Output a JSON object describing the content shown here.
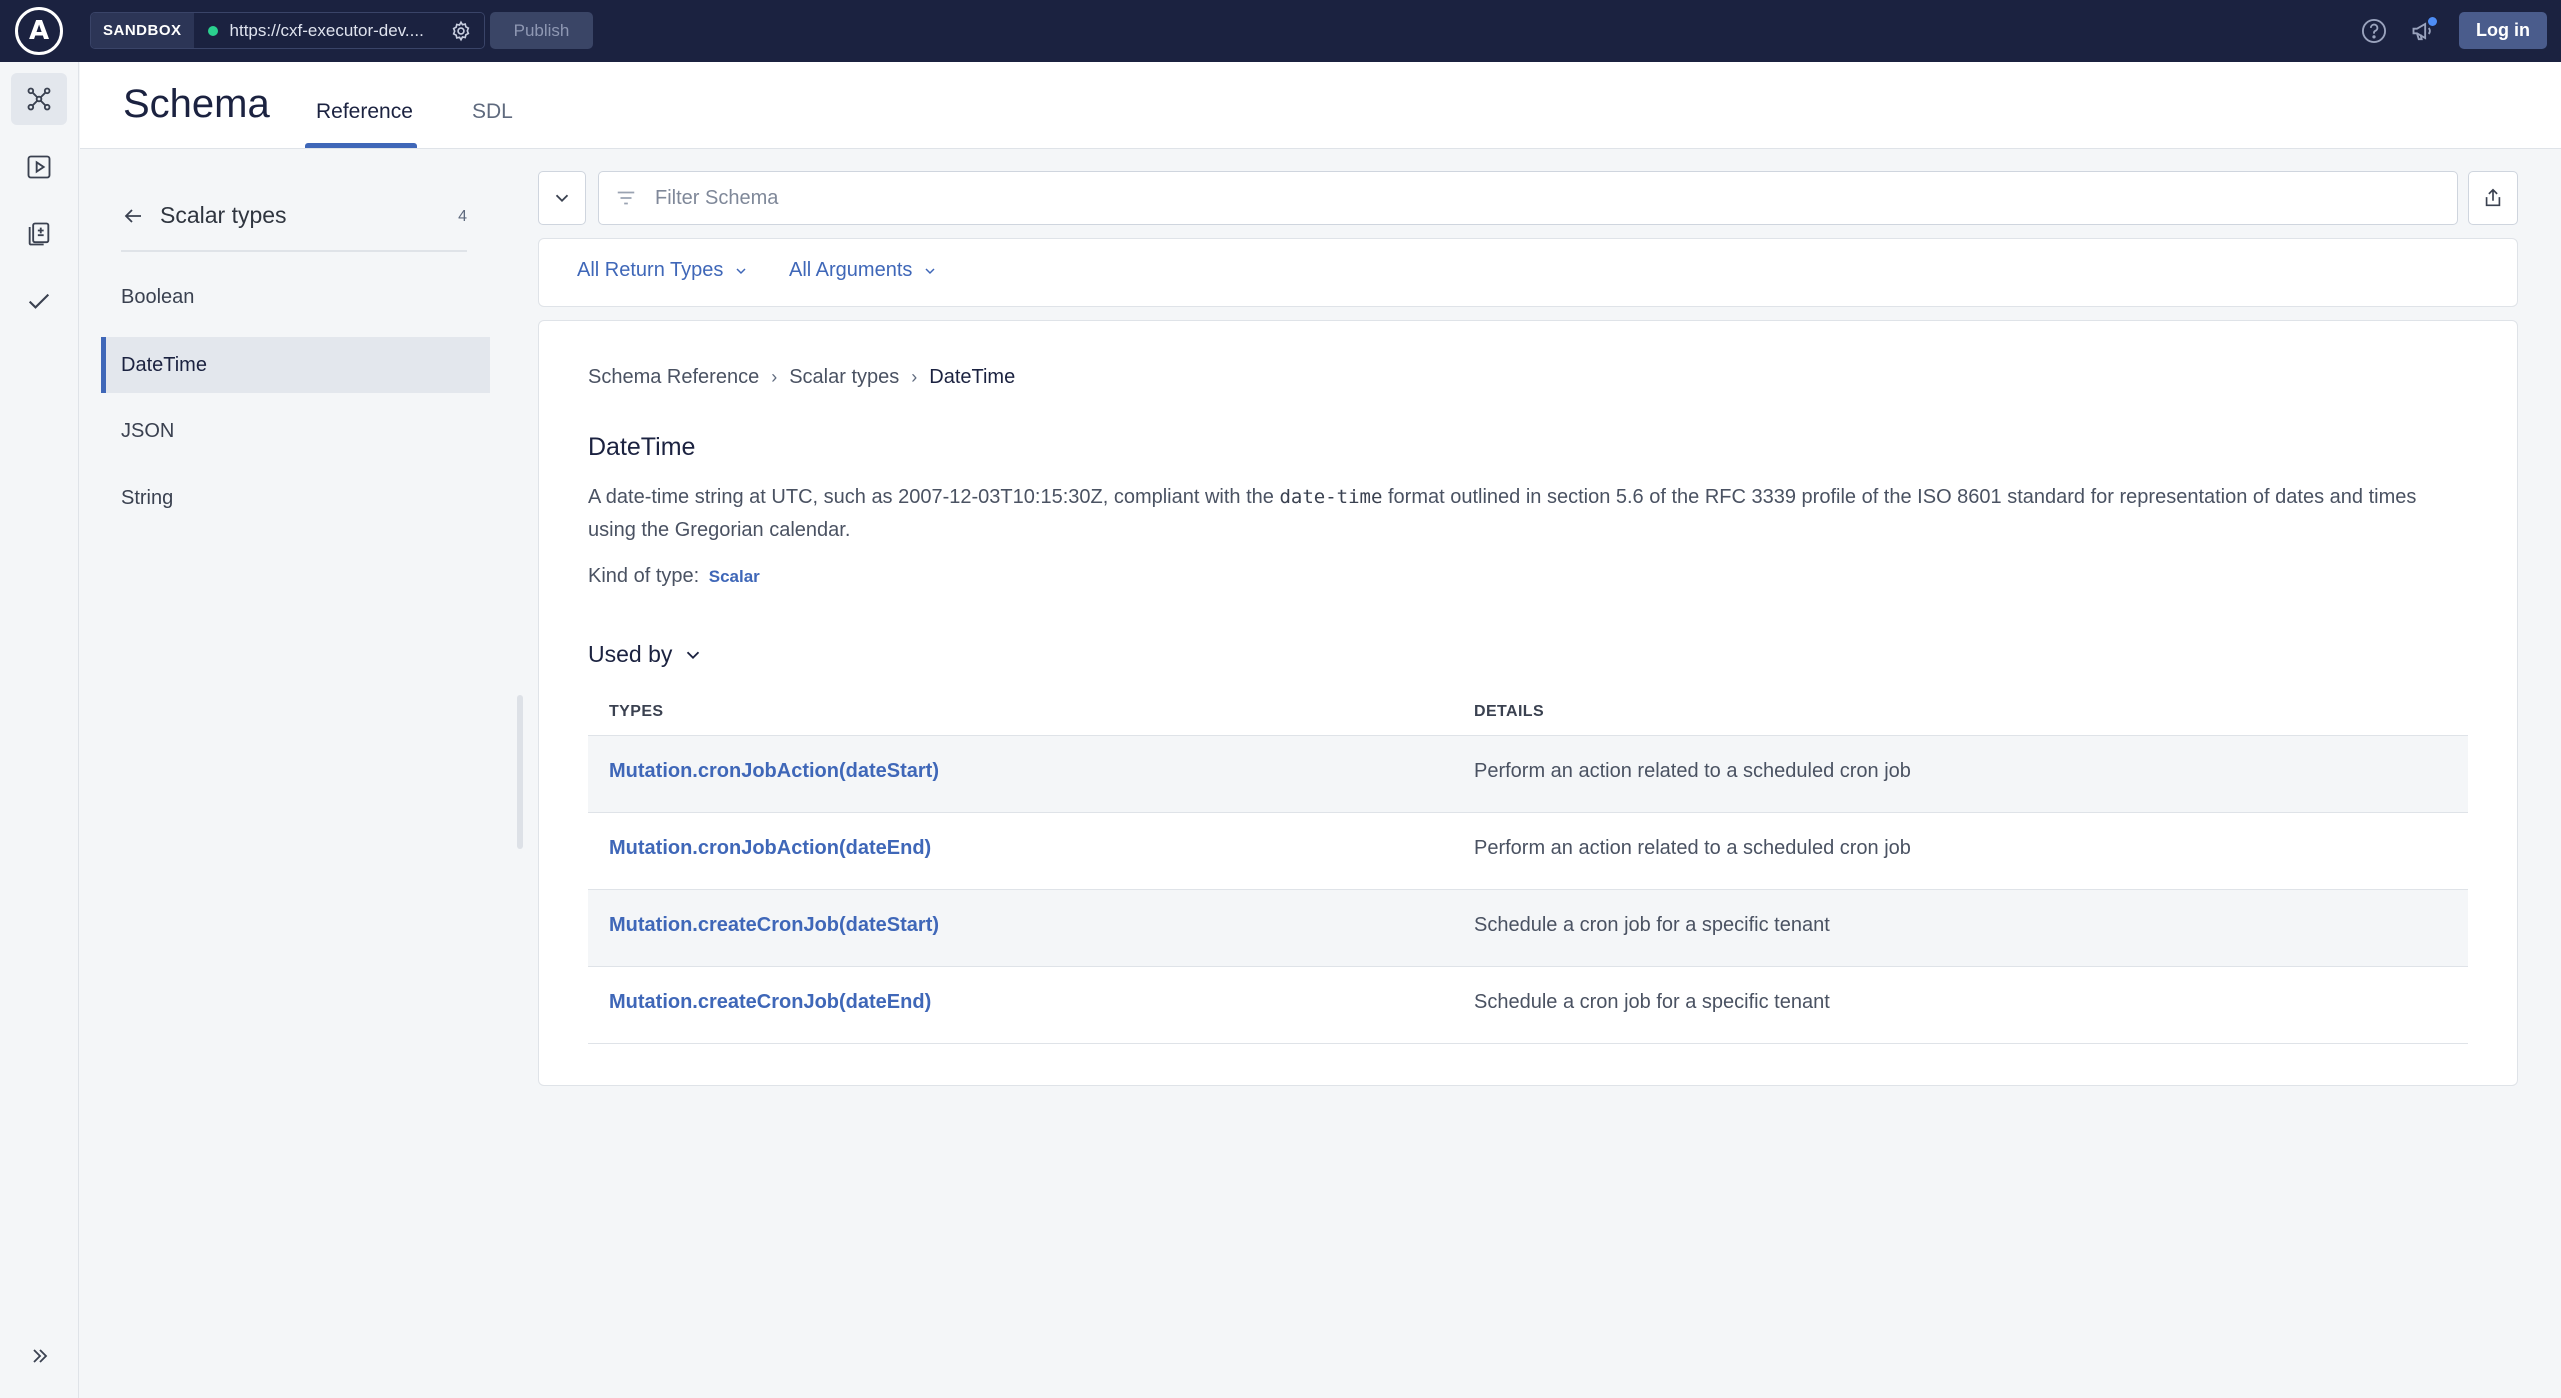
{
  "topbar": {
    "logo": "A",
    "env_badge": "SANDBOX",
    "endpoint_url": "https://cxf-executor-dev....",
    "status_color": "#2bd18f",
    "publish_label": "Publish",
    "login_label": "Log in",
    "icons": [
      "help-icon",
      "megaphone-icon",
      "gear-icon"
    ]
  },
  "rail": {
    "items": [
      "schema-icon",
      "explorer-icon",
      "operations-icon",
      "checks-icon"
    ],
    "collapse_icon": "double-chevron-right-icon"
  },
  "header": {
    "title": "Schema",
    "tabs": [
      {
        "label": "Reference",
        "active": true
      },
      {
        "label": "SDL",
        "active": false
      }
    ]
  },
  "sidebar": {
    "title": "Scalar types",
    "count": "4",
    "items": [
      {
        "label": "Boolean",
        "active": false
      },
      {
        "label": "DateTime",
        "active": true
      },
      {
        "label": "JSON",
        "active": false
      },
      {
        "label": "String",
        "active": false
      }
    ]
  },
  "filter": {
    "placeholder": "Filter Schema",
    "return_types": "All Return Types",
    "arguments": "All Arguments"
  },
  "detail": {
    "breadcrumb": [
      "Schema Reference",
      "Scalar types",
      "DateTime"
    ],
    "title": "DateTime",
    "desc_before": "A date-time string at UTC, such as 2007-12-03T10:15:30Z, compliant with the ",
    "desc_code": "date-time",
    "desc_after": " format outlined in section 5.6 of the RFC 3339 profile of the ISO 8601 standard for representation of dates and times using the Gregorian calendar.",
    "kind_label": "Kind of type:",
    "kind_value": "Scalar",
    "used_by_label": "Used by",
    "table": {
      "headers": [
        "TYPES",
        "DETAILS"
      ],
      "rows": [
        {
          "type": "Mutation.cronJobAction(dateStart)",
          "details": "Perform an action related to a scheduled cron job"
        },
        {
          "type": "Mutation.cronJobAction(dateEnd)",
          "details": "Perform an action related to a scheduled cron job"
        },
        {
          "type": "Mutation.createCronJob(dateStart)",
          "details": "Schedule a cron job for a specific tenant"
        },
        {
          "type": "Mutation.createCronJob(dateEnd)",
          "details": "Schedule a cron job for a specific tenant"
        }
      ]
    }
  },
  "colors": {
    "topbar_bg": "#1b2240",
    "accent": "#3f67b8",
    "background": "#f4f6f8"
  }
}
